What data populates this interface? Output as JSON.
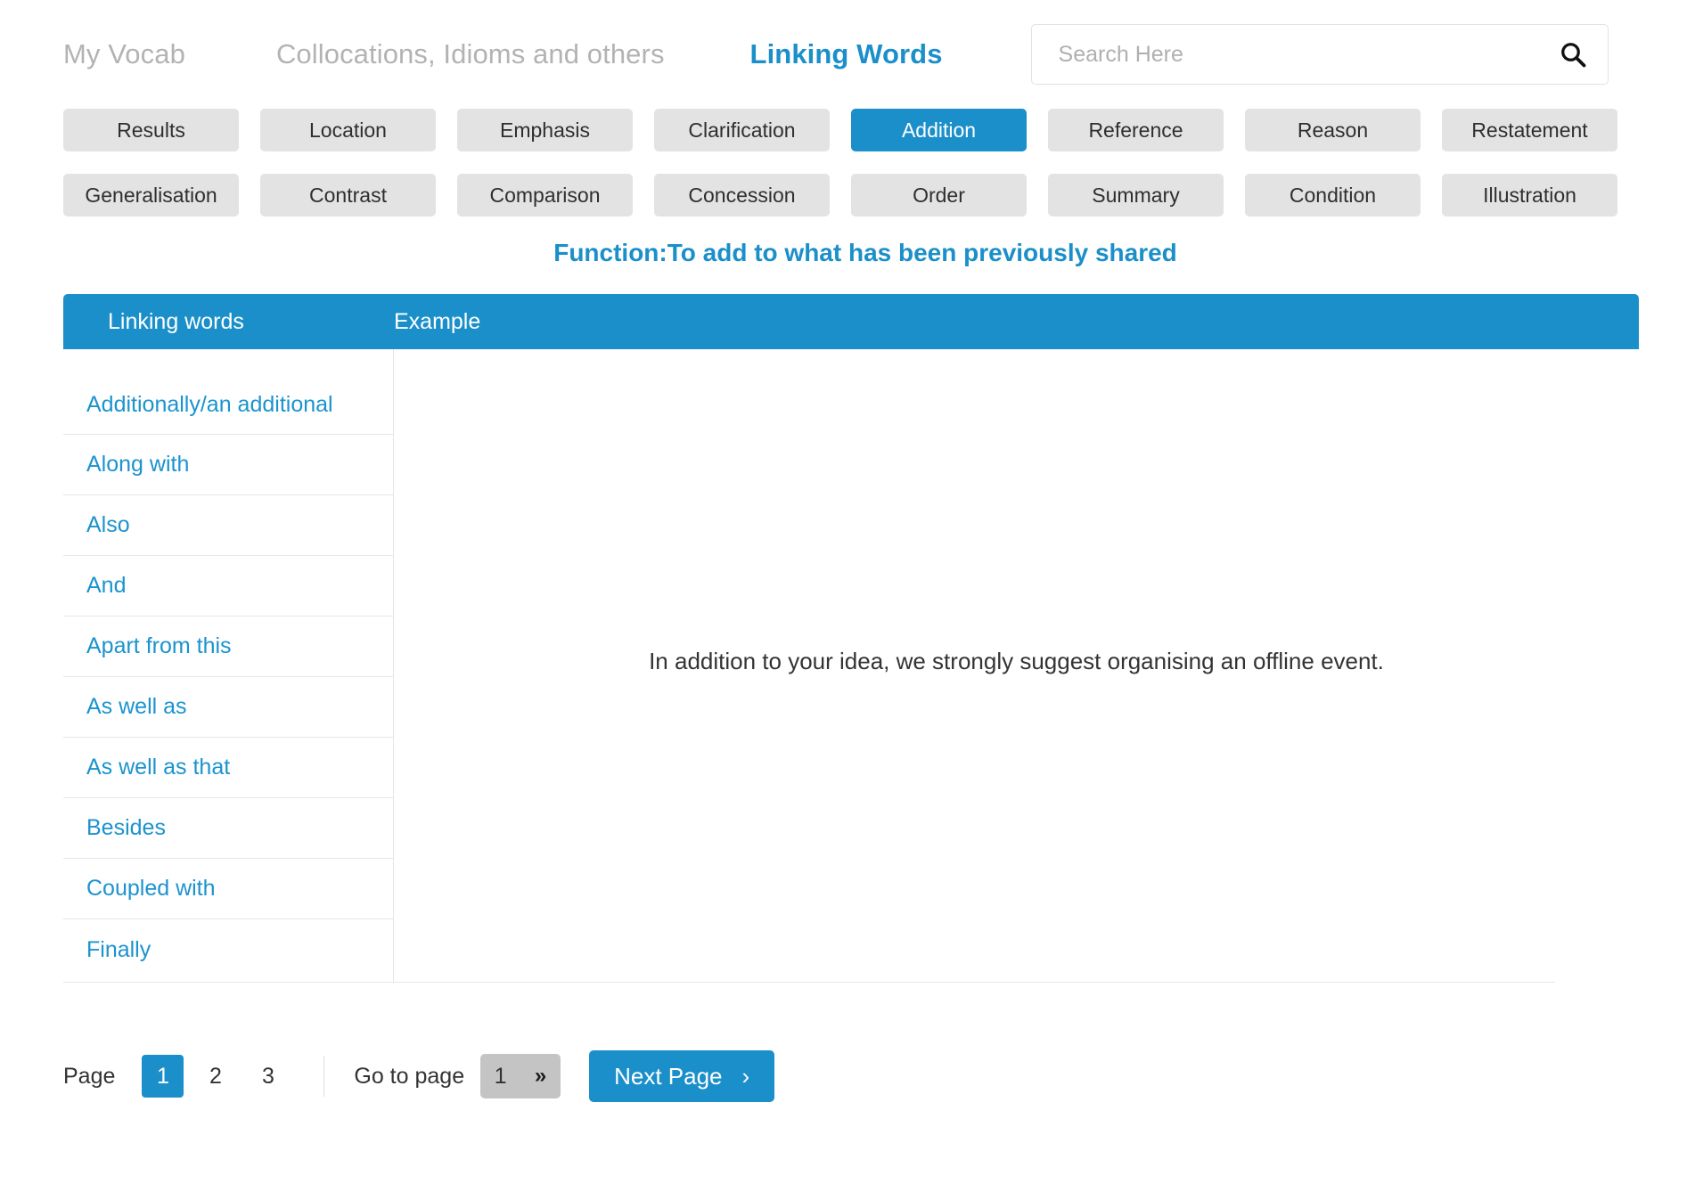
{
  "header": {
    "nav": [
      {
        "label": "My Vocab",
        "active": false
      },
      {
        "label": "Collocations, Idioms and others",
        "active": false
      },
      {
        "label": "Linking Words",
        "active": true
      }
    ],
    "search": {
      "placeholder": "Search Here",
      "value": "",
      "icon": "search-icon"
    }
  },
  "categories": {
    "row1": [
      {
        "label": "Results",
        "selected": false
      },
      {
        "label": "Location",
        "selected": false
      },
      {
        "label": "Emphasis",
        "selected": false
      },
      {
        "label": "Clarification",
        "selected": false
      },
      {
        "label": "Addition",
        "selected": true
      },
      {
        "label": "Reference",
        "selected": false
      },
      {
        "label": "Reason",
        "selected": false
      },
      {
        "label": "Restatement",
        "selected": false
      }
    ],
    "row2": [
      {
        "label": "Generalisation",
        "selected": false
      },
      {
        "label": "Contrast",
        "selected": false
      },
      {
        "label": "Comparison",
        "selected": false
      },
      {
        "label": "Concession",
        "selected": false
      },
      {
        "label": "Order",
        "selected": false
      },
      {
        "label": "Summary",
        "selected": false
      },
      {
        "label": "Condition",
        "selected": false
      },
      {
        "label": "Illustration",
        "selected": false
      }
    ]
  },
  "function_line": "Function:To add to what has been previously shared",
  "table": {
    "headers": {
      "words": "Linking words",
      "example": "Example"
    },
    "words": [
      "Additionally/an additional",
      "Along with",
      "Also",
      "And",
      "Apart from this",
      "As well as",
      "As well as that",
      "Besides",
      "Coupled with",
      "Finally"
    ],
    "example_text": "In addition to your idea, we strongly suggest organising an offline event."
  },
  "pagination": {
    "page_label": "Page",
    "pages": [
      "1",
      "2",
      "3"
    ],
    "current_page": "1",
    "goto_label": "Go to page",
    "goto_value": "1",
    "goto_chevron": "»",
    "next_label": "Next Page",
    "next_chevron": "›"
  },
  "colors": {
    "accent_blue": "#1b8fc9",
    "link_blue": "#1b93cf",
    "button_gray": "#e3e3e3",
    "goto_gray": "#c4c4c4",
    "nav_gray": "#b3b3b3"
  }
}
